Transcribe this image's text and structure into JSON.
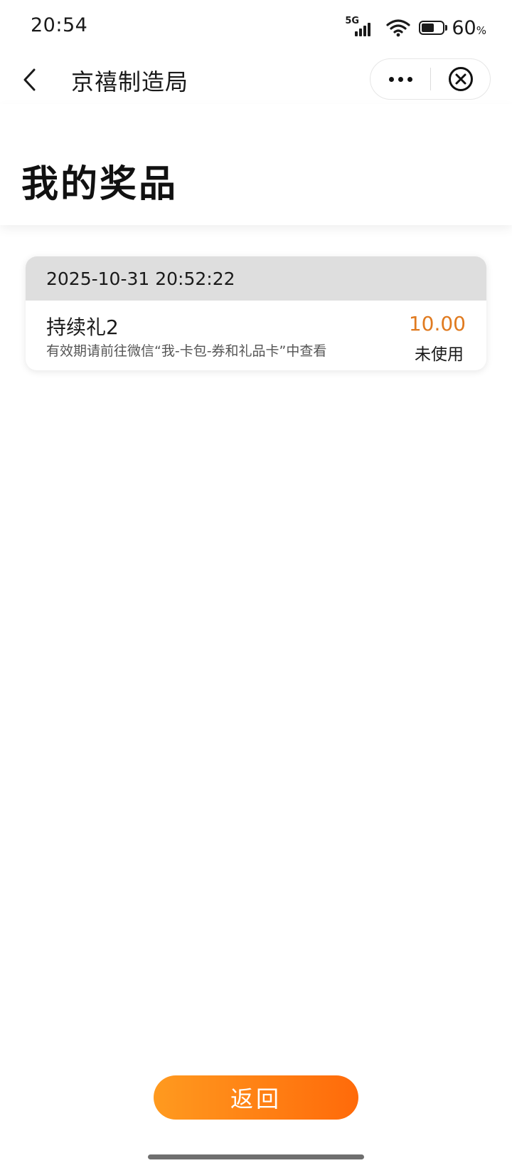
{
  "status_bar": {
    "time": "20:54",
    "network": "5G",
    "battery_percent": 60,
    "battery_text": "60",
    "battery_unit": "%"
  },
  "nav": {
    "back_icon": "chevron-left-icon",
    "title": "京禧制造局",
    "more_icon": "more-dots-icon",
    "close_icon": "circle-close-icon"
  },
  "page": {
    "title": "我的奖品"
  },
  "prizes": [
    {
      "datetime": "2025-10-31 20:52:22",
      "name": "持续礼2",
      "description": "有效期请前往微信“我-卡包-券和礼品卡”中查看",
      "amount": "10.00",
      "status": "未使用"
    }
  ],
  "footer": {
    "return_label": "返回"
  },
  "colors": {
    "accent_amount": "#e07a1f",
    "button_gradient_start": "#ff9a1f",
    "button_gradient_end": "#ff6a0a",
    "card_header_bg": "#dedede"
  }
}
